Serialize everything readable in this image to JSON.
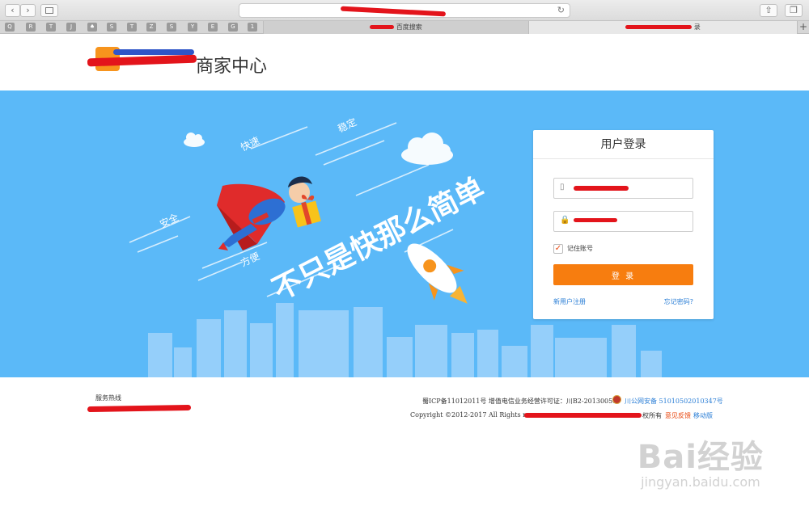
{
  "browser": {
    "tabs": [
      {
        "label": "百度搜索"
      },
      {
        "label": "录"
      }
    ],
    "bookmarks": [
      "Q",
      "R",
      "T",
      "J",
      "♠",
      "S",
      "T",
      "Z",
      "S",
      "Y",
      "E",
      "G",
      "1"
    ],
    "add_tab": "+",
    "back_icon": "‹",
    "forward_icon": "›",
    "reload_icon": "↻"
  },
  "header": {
    "title": "商家中心"
  },
  "hero": {
    "slogan": "不只是快那么简单",
    "tags": [
      "安全",
      "方便",
      "快速",
      "稳定"
    ]
  },
  "login": {
    "title": "用户登录",
    "username_placeholder": "",
    "password_placeholder": "",
    "remember_label": "记住账号",
    "submit_label": "登 录",
    "register_link": "新用户注册",
    "forgot_link": "忘记密码?"
  },
  "footer": {
    "hotline_label": "服务热线",
    "icp": "蜀ICP备11012011号 增值电信业务经营许可证：川B2-20130058",
    "police": "川公网安备 51010502010347号",
    "copyright_prefix": "Copyright ©2012-2017 All Rights reserve",
    "rights_suffix": "权所有",
    "feedback_link": "意见反馈",
    "mobile_link": "移动版"
  },
  "watermark": {
    "brand": "Bai经验",
    "url": "jingyan.baidu.com"
  },
  "colors": {
    "hero_bg": "#5bb9f8",
    "accent": "#f77d0f",
    "link": "#2a7ed6",
    "redaction": "#e3141b"
  }
}
